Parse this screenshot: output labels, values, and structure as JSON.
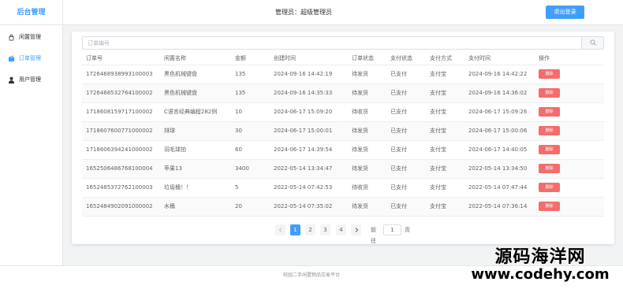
{
  "header": {
    "brand": "后台管理",
    "admin_info": "管理员：超级管理员",
    "logout_label": "退出登录"
  },
  "sidebar": {
    "items": [
      {
        "label": "闲置管理",
        "icon": "bag-icon"
      },
      {
        "label": "订单管理",
        "icon": "wallet-icon"
      },
      {
        "label": "用户管理",
        "icon": "user-icon"
      }
    ],
    "active_index": 1
  },
  "search": {
    "placeholder": "订单编号",
    "value": ""
  },
  "table": {
    "headers": [
      "订单号",
      "闲置名称",
      "金额",
      "创建时间",
      "订单状态",
      "支付状态",
      "支付方式",
      "支付时间",
      "操作"
    ],
    "delete_label": "删除",
    "rows": [
      [
        "1726468938993100003",
        "黑色机械键盘",
        "135",
        "2024-09-16 14:42:19",
        "待发货",
        "已支付",
        "支付宝",
        "2024-09-16 14:42:22"
      ],
      [
        "1726468532764100002",
        "黑色机械键盘",
        "135",
        "2024-09-16 14:35:33",
        "待发货",
        "已支付",
        "支付宝",
        "2024-09-16 14:36:02"
      ],
      [
        "1718608159717100002",
        "C语言经典编程282例",
        "10",
        "2024-06-17 15:09:20",
        "待收货",
        "已支付",
        "支付宝",
        "2024-06-17 15:09:26"
      ],
      [
        "1718607600771000002",
        "排球",
        "30",
        "2024-06-17 15:00:01",
        "待发货",
        "已支付",
        "支付宝",
        "2024-06-17 15:00:06"
      ],
      [
        "1718606394241000002",
        "羽毛球拍",
        "60",
        "2024-06-17 14:39:54",
        "待发货",
        "已支付",
        "支付宝",
        "2024-06-17 14:40:05"
      ],
      [
        "1652506486768100004",
        "苹果13",
        "3400",
        "2022-05-14 13:34:47",
        "待发货",
        "已支付",
        "支付宝",
        "2022-05-14 13:34:50"
      ],
      [
        "1652485372762100003",
        "垃圾桶！！",
        "5",
        "2022-05-14 07:42:53",
        "待收货",
        "已支付",
        "支付宝",
        "2022-05-14 07:47:44"
      ],
      [
        "1652484902091000002",
        "水桶",
        "20",
        "2022-05-14 07:35:02",
        "待发货",
        "已支付",
        "支付宝",
        "2022-05-14 07:36:14"
      ]
    ]
  },
  "pagination": {
    "pages": [
      "1",
      "2",
      "3",
      "4"
    ],
    "current": "1",
    "goto_prefix": "前往",
    "goto_value": "1",
    "goto_suffix": "页"
  },
  "footer": {
    "text": "校园二手闲置物品交易平台"
  },
  "watermark": {
    "line1": "源码海洋网",
    "line2": "www.codehy.com"
  },
  "colors": {
    "primary": "#409eff",
    "danger": "#f56c6c"
  }
}
